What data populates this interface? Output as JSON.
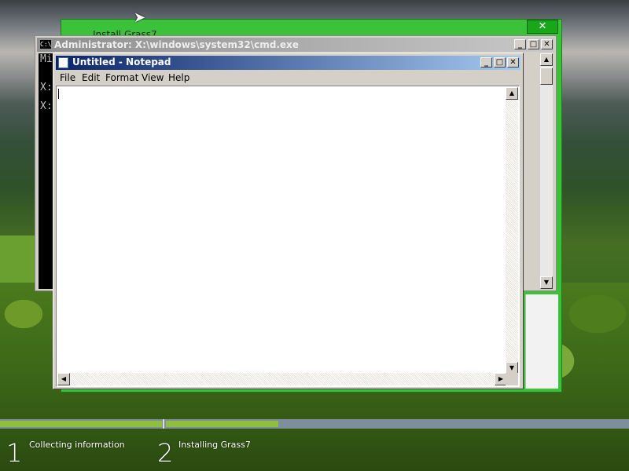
{
  "installer": {
    "title": "Install Grass7",
    "close_label": "✕"
  },
  "cmd": {
    "title": "Administrator: X:\\windows\\system32\\cmd.exe",
    "icon_text": "C:\\",
    "lines": [
      "Mi",
      "X:",
      "X:"
    ],
    "buttons": {
      "minimize": "_",
      "maximize": "□",
      "close": "✕"
    }
  },
  "notepad": {
    "title": "Untitled - Notepad",
    "menu": [
      "File",
      "Edit",
      "Format",
      "View",
      "Help"
    ],
    "content": "",
    "buttons": {
      "minimize": "_",
      "maximize": "□",
      "close": "✕"
    }
  },
  "setup": {
    "steps": [
      {
        "number": "1",
        "label": "Collecting information"
      },
      {
        "number": "2",
        "label": "Installing Grass7"
      }
    ]
  },
  "icons": [
    "arrow-cursor-icon",
    "cmd-icon",
    "notepad-icon",
    "close-icon",
    "minimize-icon",
    "maximize-icon",
    "scroll-up-icon",
    "scroll-down-icon",
    "scroll-left-icon",
    "scroll-right-icon"
  ]
}
